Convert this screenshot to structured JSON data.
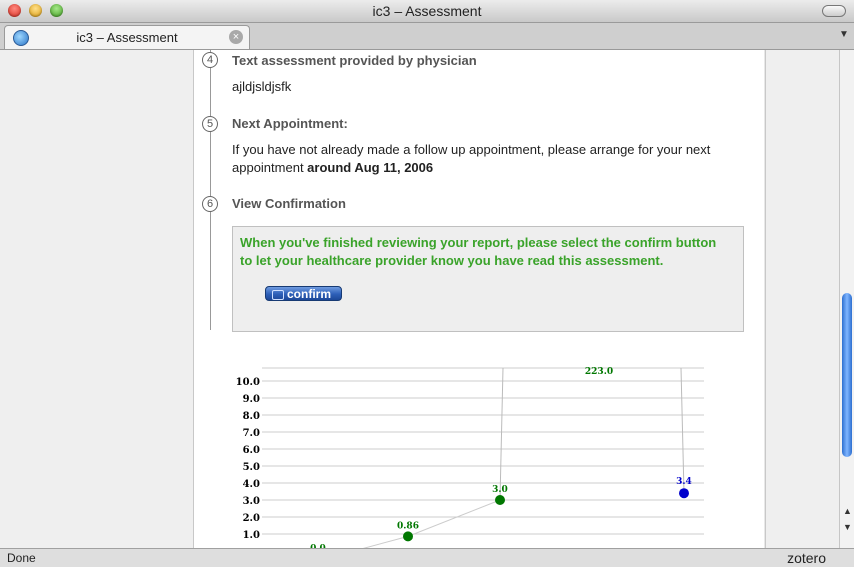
{
  "window": {
    "title": "ic3 – Assessment"
  },
  "tab": {
    "label": "ic3 – Assessment"
  },
  "status": {
    "text": "Done",
    "extension": "zotero"
  },
  "steps": [
    {
      "number": "4",
      "title": "Text assessment provided by physician",
      "body": "ajldjsldjsfk"
    },
    {
      "number": "5",
      "title": "Next Appointment:",
      "body_prefix": "If you have not already made a follow up appointment, please arrange for your next appointment",
      "body_bold": " around Aug 11, 2006"
    },
    {
      "number": "6",
      "title": "View Confirmation"
    }
  ],
  "confirmation": {
    "message": "When you've finished reviewing your report, please select the confirm button to let your healthcare provider know you have read this assessment.",
    "button_label": "confirm"
  },
  "colors": {
    "confirm_text": "#3aa32a",
    "series_green": "#007700",
    "series_blue": "#0000cc"
  },
  "chart_data": {
    "type": "line",
    "y_ticks": [
      "1.0",
      "2.0",
      "3.0",
      "4.0",
      "5.0",
      "6.0",
      "7.0",
      "8.0",
      "9.0",
      "10.0"
    ],
    "ylim": [
      0,
      10
    ],
    "grid": true,
    "series": [
      {
        "color": "#007700",
        "points": [
          {
            "label": "0.0",
            "value": 0.0
          },
          {
            "label": "0.86",
            "value": 0.86
          },
          {
            "label": "3.0",
            "value": 3.0
          }
        ]
      },
      {
        "color": "#0000cc",
        "points": [
          {
            "label": "3.4",
            "value": 3.4
          }
        ]
      }
    ],
    "annotations": [
      {
        "label": "223.0"
      }
    ]
  }
}
